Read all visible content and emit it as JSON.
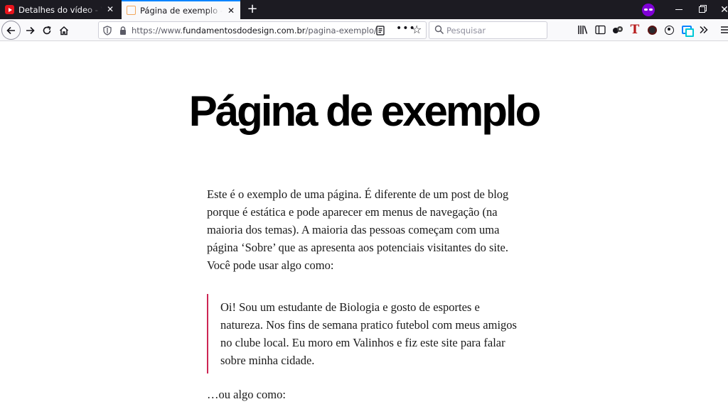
{
  "browser": {
    "tabs": [
      {
        "title": "Detalhes do vídeo - YouTube Studio",
        "favicon": "youtube-icon"
      },
      {
        "title": "Página de exemplo - Fundamentos do Design",
        "favicon": "page-icon",
        "active": true
      }
    ],
    "url_prefix": "https://www.",
    "url_host": "fundamentosdodesign.com.br",
    "url_path": "/pagina-exemplo/",
    "search_placeholder": "Pesquisar",
    "colors": {
      "tabstrip": "#1c1b22",
      "active_tab": "#f9f9fb",
      "accent": "#0a84ff",
      "privacy": "#8000d7"
    }
  },
  "page": {
    "title": "Página de exemplo",
    "paragraph1": "Este é o exemplo de uma página. É diferente de um post de blog porque é estática e pode aparecer em menus de navegação (na maioria dos temas). A maioria das pessoas começam com uma página ‘Sobre’ que as apresenta aos potenciais visitantes do site. Você pode usar algo como:",
    "quote": "Oi! Sou um estudante de Biologia e gosto de esportes e natureza. Nos fins de semana pratico futebol com meus amigos no clube local. Eu moro em Valinhos e fiz este site para falar sobre minha cidade.",
    "paragraph2": "…ou algo como:",
    "colors": {
      "quote_border": "#cd2653"
    }
  }
}
